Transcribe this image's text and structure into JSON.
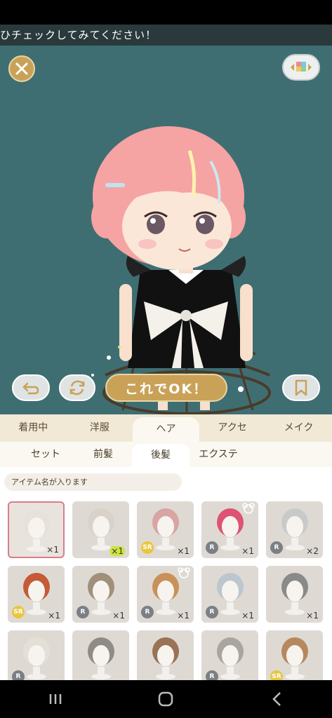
{
  "banner": {
    "text": "ひチェックしてみてください！"
  },
  "stage": {
    "ok_label": "これでOK！"
  },
  "category_tabs": [
    {
      "label": "着用中"
    },
    {
      "label": "洋服"
    },
    {
      "label": "ヘア"
    },
    {
      "label": "アクセ"
    },
    {
      "label": "メイク"
    }
  ],
  "sub_tabs": [
    {
      "label": "セット"
    },
    {
      "label": "前髪"
    },
    {
      "label": "後髪"
    },
    {
      "label": "エクステ"
    }
  ],
  "search": {
    "placeholder": "アイテム名が入ります"
  },
  "items": [
    {
      "hair": "#e6e1da",
      "rarity": "",
      "qty": "×1"
    },
    {
      "hair": "#d8d2ca",
      "rarity": "",
      "qty": "×1"
    },
    {
      "hair": "#d9a4a4",
      "rarity": "SR",
      "qty": "×1"
    },
    {
      "hair": "#de5273",
      "rarity": "R",
      "qty": "×1"
    },
    {
      "hair": "#c9c9c9",
      "rarity": "R",
      "qty": "×2"
    },
    {
      "hair": "#c55a36",
      "rarity": "SR",
      "qty": "×1"
    },
    {
      "hair": "#a08f7a",
      "rarity": "R",
      "qty": "×1"
    },
    {
      "hair": "#c9915a",
      "rarity": "R",
      "qty": "×1"
    },
    {
      "hair": "#bcc6cf",
      "rarity": "R",
      "qty": "×1"
    },
    {
      "hair": "#8a8a8a",
      "rarity": "",
      "qty": "×1"
    },
    {
      "hair": "#e3e0d8",
      "rarity": "R",
      "qty": ""
    },
    {
      "hair": "#8f8c86",
      "rarity": "",
      "qty": ""
    },
    {
      "hair": "#9a7256",
      "rarity": "",
      "qty": ""
    },
    {
      "hair": "#a9a6a0",
      "rarity": "R",
      "qty": ""
    },
    {
      "hair": "#b7885e",
      "rarity": "SR",
      "qty": ""
    }
  ],
  "colors": {
    "accent_gold": "#c9a258",
    "stage_bg": "#3f6e72",
    "tab_bg": "#f1e8d6"
  }
}
